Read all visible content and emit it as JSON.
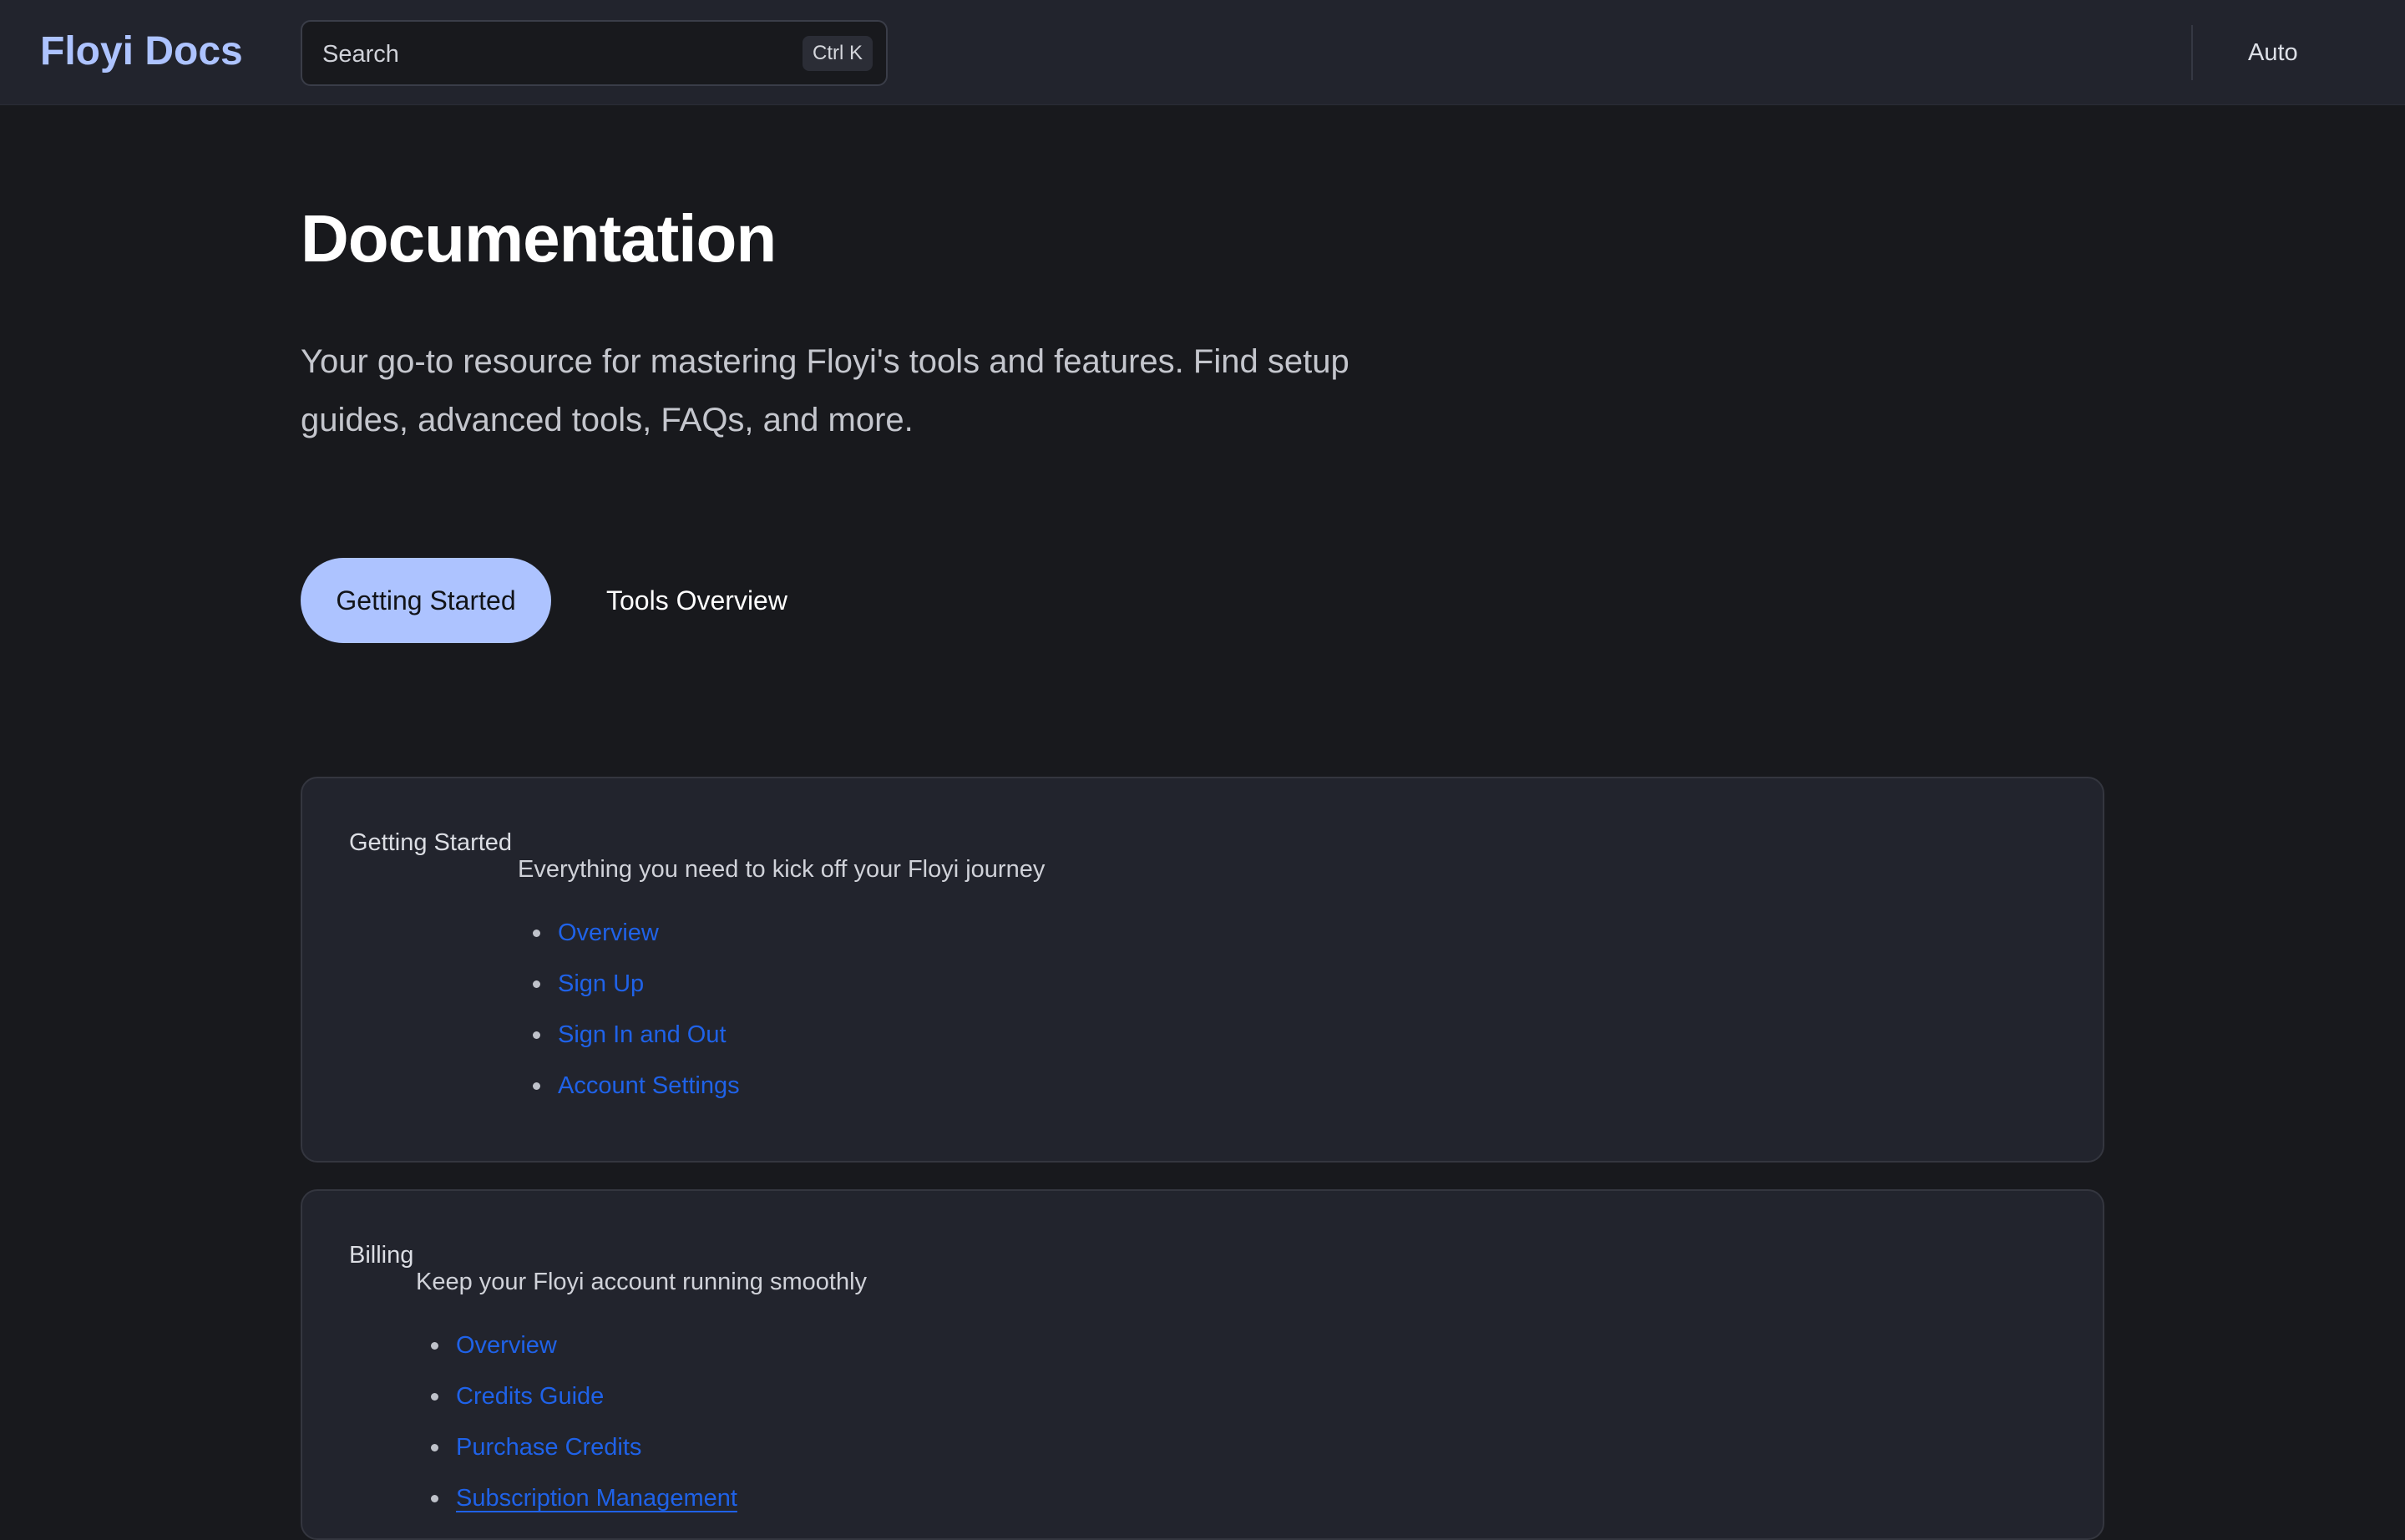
{
  "header": {
    "brand": "Floyi Docs",
    "search": {
      "placeholder": "Search",
      "shortcut": "Ctrl K"
    },
    "theme_toggle": "Auto"
  },
  "hero": {
    "title": "Documentation",
    "subtitle": "Your go-to resource for mastering Floyi's tools and features. Find setup guides, advanced tools, FAQs, and more."
  },
  "tabs": [
    {
      "label": "Getting Started",
      "active": true
    },
    {
      "label": "Tools Overview",
      "active": false
    }
  ],
  "sections": [
    {
      "title": "Getting Started",
      "description": "Everything you need to kick off your Floyi journey",
      "links": [
        "Overview",
        "Sign Up",
        "Sign In and Out",
        "Account Settings"
      ]
    },
    {
      "title": "Billing",
      "description": "Keep your Floyi account running smoothly",
      "links": [
        "Overview",
        "Credits Guide",
        "Purchase Credits",
        "Subscription Management"
      ]
    }
  ],
  "colors": {
    "brand": "#adc3ff",
    "active_tab_bg": "#adc3ff",
    "link": "#1f62e8",
    "background": "#18191d",
    "card_bg": "#22242d"
  }
}
